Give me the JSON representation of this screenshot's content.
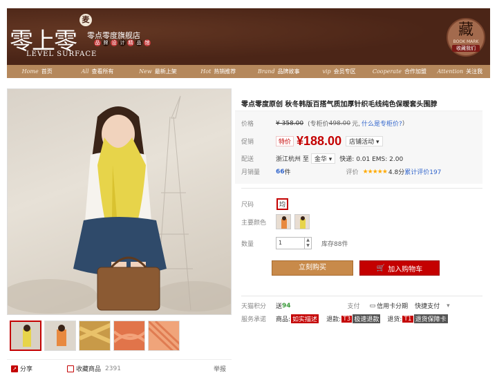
{
  "shop": {
    "logo_cn": "零上零",
    "logo_badge": "麦",
    "logo_en": "LEVEL SURFACE",
    "name": "零点零度旗舰店",
    "tags": [
      "品",
      "牌",
      "设",
      "计",
      "精",
      "品",
      "馆"
    ],
    "collect_big": "藏",
    "collect_en": "BOOK MARK",
    "collect_cn": "收藏我们"
  },
  "nav": [
    {
      "en": "Home",
      "cn": "首页"
    },
    {
      "en": "All",
      "cn": "查看所有"
    },
    {
      "en": "New",
      "cn": "最新上架"
    },
    {
      "en": "Hot",
      "cn": "热销推荐"
    },
    {
      "en": "Brand",
      "cn": "品牌故事"
    },
    {
      "en": "vip",
      "cn": "会员专区"
    },
    {
      "en": "Cooperate",
      "cn": "合作加盟"
    },
    {
      "en": "Attention",
      "cn": "关注我"
    }
  ],
  "product": {
    "title": "零点零度原创 秋冬韩版百搭气质加厚针织毛线纯色保暖套头围脖",
    "price_label": "价格",
    "price": "¥ 358.00",
    "vip_text": "(专柜价",
    "vip_price": "498.00",
    "vip_suffix": "元,",
    "vip_link": "什么是专柜价?",
    "vip_close": ")",
    "promo_label": "促销",
    "promo_badge": "特价",
    "promo_price": "¥188.00",
    "promo_dropdown": "店铺活动",
    "ship_label": "配送",
    "ship_from": "浙江杭州 至",
    "ship_to": "金华",
    "ship_fee": "快递: 0.01 EMS: 2.00",
    "sales_label": "月销量",
    "sales_value": "66",
    "sales_unit": "件",
    "rating_label": "评价",
    "rating_stars": "★★★★★",
    "rating_score": "4.8分",
    "rating_link": "累计评价197",
    "size_label": "尺码",
    "size_value": "均",
    "color_label": "主要颜色",
    "qty_label": "数量",
    "qty_value": "1",
    "stock": "库存88件",
    "buy_now": "立刻购买",
    "add_cart": "加入购物车",
    "points_label": "天猫积分",
    "points_prefix": "送",
    "points_value": "94",
    "pay_label": "支付",
    "pay_card": "信用卡分期",
    "pay_quick": "快捷支付",
    "service_label": "服务承诺",
    "service_1": "商品:",
    "service_1_pill": "如实描述",
    "service_2": "退款:",
    "service_2_tag": "T3",
    "service_2_pill": "极速退款",
    "service_3": "退货:",
    "service_3_tag": "T1",
    "service_3_pill": "退货保障卡"
  },
  "actions": {
    "share": "分享",
    "favorite": "收藏商品",
    "favorite_count": "2391",
    "report": "举报"
  },
  "colors": {
    "brand_brown": "#4b2517",
    "nav_tan": "#b5885c",
    "accent_red": "#c40000",
    "buy_orange": "#c88a4a"
  }
}
